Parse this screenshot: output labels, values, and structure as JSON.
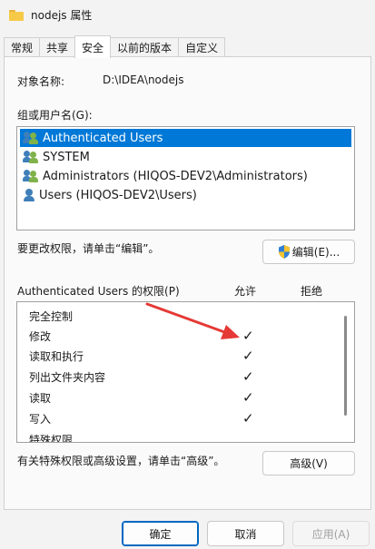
{
  "window": {
    "title": "nodejs 属性"
  },
  "tabs": [
    {
      "label": "常规",
      "active": false
    },
    {
      "label": "共享",
      "active": false
    },
    {
      "label": "安全",
      "active": true
    },
    {
      "label": "以前的版本",
      "active": false
    },
    {
      "label": "自定义",
      "active": false
    }
  ],
  "security": {
    "object_name_label": "对象名称:",
    "object_name_value": "D:\\IDEA\\nodejs",
    "groups_label": "组或用户名(G):",
    "users": [
      {
        "name": "Authenticated Users",
        "icon": "users-group-icon",
        "selected": true
      },
      {
        "name": "SYSTEM",
        "icon": "users-group-icon",
        "selected": false
      },
      {
        "name": "Administrators (HIQOS-DEV2\\Administrators)",
        "icon": "users-group-icon",
        "selected": false
      },
      {
        "name": "Users (HIQOS-DEV2\\Users)",
        "icon": "user-icon",
        "selected": false
      }
    ],
    "edit_hint": "要更改权限，请单击“编辑”。",
    "edit_button": "编辑(E)...",
    "permissions_label": "Authenticated Users 的权限(P)",
    "allow_header": "允许",
    "deny_header": "拒绝",
    "permissions": [
      {
        "name": "完全控制",
        "allow": false,
        "deny": false
      },
      {
        "name": "修改",
        "allow": true,
        "deny": false
      },
      {
        "name": "读取和执行",
        "allow": true,
        "deny": false
      },
      {
        "name": "列出文件夹内容",
        "allow": true,
        "deny": false
      },
      {
        "name": "读取",
        "allow": true,
        "deny": false
      },
      {
        "name": "写入",
        "allow": true,
        "deny": false
      },
      {
        "name": "特殊权限",
        "allow": false,
        "deny": false
      }
    ],
    "check_glyph": "✓",
    "advanced_hint": "有关特殊权限或高级设置，请单击“高级”。",
    "advanced_button": "高级(V)"
  },
  "footer": {
    "ok": "确定",
    "cancel": "取消",
    "apply": "应用(A)"
  },
  "colors": {
    "selection": "#0078d7",
    "annotation_arrow": "#e53935",
    "primary_border": "#0067c0"
  }
}
